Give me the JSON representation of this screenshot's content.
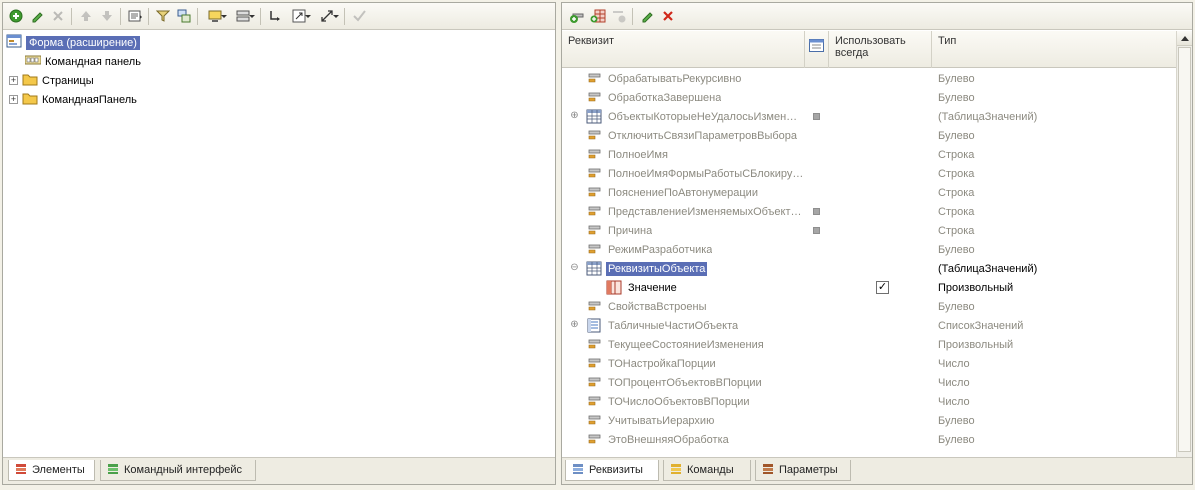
{
  "left_panel": {
    "toolbar": [
      "add-icon",
      "edit-icon",
      "delete-icon",
      "move-up-icon",
      "move-down-icon",
      "properties-icon",
      "filter-icon",
      "replace-icon",
      "display-icon",
      "layout-icon",
      "link-icon",
      "resize-icon",
      "expand-icon",
      "check-icon"
    ],
    "tree": {
      "root_label": "Форма (расширение)",
      "items": [
        {
          "label": "Командная панель",
          "expandable": false,
          "icon": "command-panel-icon"
        },
        {
          "label": "Страницы",
          "expandable": true,
          "icon": "folder-icon"
        },
        {
          "label": "КоманднаяПанель",
          "expandable": true,
          "icon": "folder-icon"
        }
      ]
    },
    "tabs": [
      {
        "label": "Элементы",
        "active": true
      },
      {
        "label": "Командный интерфейс",
        "active": false
      }
    ]
  },
  "right_panel": {
    "toolbar": [
      "add-attribute-icon",
      "add-column-icon",
      "add-disabled-icon",
      "edit-icon",
      "delete-icon"
    ],
    "columns": {
      "name": "Реквизит",
      "use_always": "Использовать всегда",
      "type": "Тип"
    },
    "rows": [
      {
        "name": "ОбрабатыватьРекурсивно",
        "type": "Булево"
      },
      {
        "name": "ОбработкаЗавершена",
        "type": "Булево"
      },
      {
        "name": "ОбъектыКоторыеНеУдалосьИзмен…",
        "type": "(ТаблицаЗначений)",
        "expandable": true,
        "icon": "table-icon",
        "marked": true
      },
      {
        "name": "ОтключитьСвязиПараметровВыбора",
        "type": "Булево"
      },
      {
        "name": "ПолноеИмя",
        "type": "Строка"
      },
      {
        "name": "ПолноеИмяФормыРаботыСБлокиру…",
        "type": "Строка"
      },
      {
        "name": "ПояснениеПоАвтонумерации",
        "type": "Строка"
      },
      {
        "name": "ПредставлениеИзменяемыхОбъект…",
        "type": "Строка",
        "marked": true
      },
      {
        "name": "Причина",
        "type": "Строка",
        "marked": true
      },
      {
        "name": "РежимРазработчика",
        "type": "Булево"
      },
      {
        "name": "РеквизитыОбъекта",
        "type": "(ТаблицаЗначений)",
        "expanded": true,
        "icon": "table-icon",
        "selected": true
      },
      {
        "name": "Значение",
        "type": "Произвольный",
        "child": true,
        "checked": true
      },
      {
        "name": "СвойстваВстроены",
        "type": "Булево"
      },
      {
        "name": "ТабличныеЧастиОбъекта",
        "type": "СписокЗначений",
        "expandable": true,
        "icon": "list-icon"
      },
      {
        "name": "ТекущееСостояниеИзменения",
        "type": "Произвольный"
      },
      {
        "name": "ТОНастройкаПорции",
        "type": "Число"
      },
      {
        "name": "ТОПроцентОбъектовВПорции",
        "type": "Число"
      },
      {
        "name": "ТОЧислоОбъектовВПорции",
        "type": "Число"
      },
      {
        "name": "УчитыватьИерархию",
        "type": "Булево"
      },
      {
        "name": "ЭтоВнешняяОбработка",
        "type": "Булево"
      }
    ],
    "tabs": [
      {
        "label": "Реквизиты",
        "active": true
      },
      {
        "label": "Команды",
        "active": false
      },
      {
        "label": "Параметры",
        "active": false
      }
    ]
  }
}
